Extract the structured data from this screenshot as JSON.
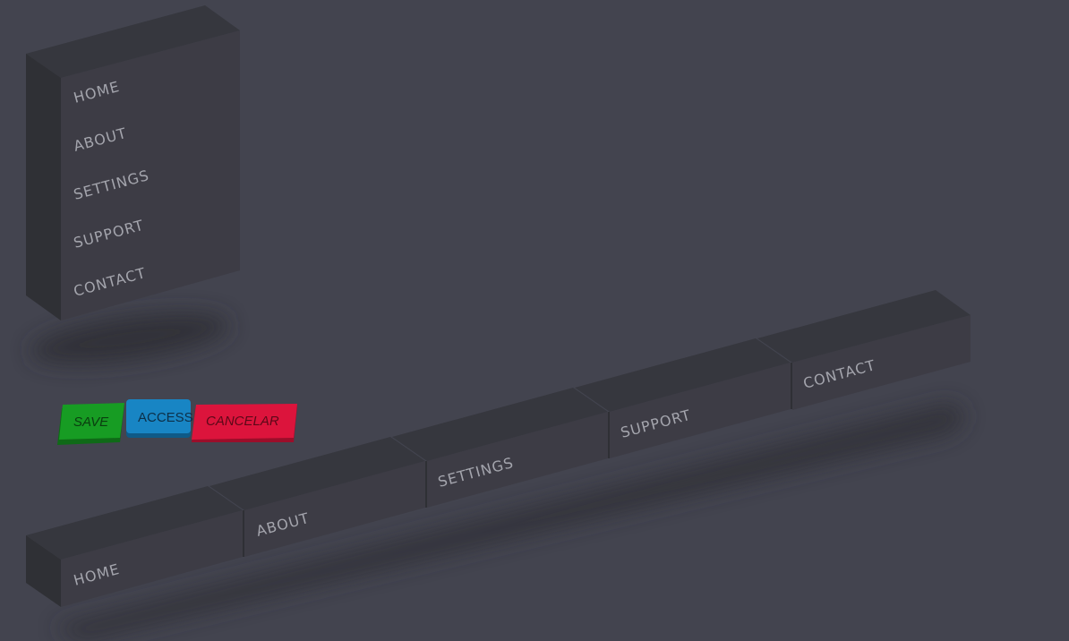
{
  "vertical_menu": {
    "items": [
      {
        "label": "HOME"
      },
      {
        "label": "ABOUT"
      },
      {
        "label": "SETTINGS"
      },
      {
        "label": "SUPPORT"
      },
      {
        "label": "CONTACT"
      }
    ]
  },
  "buttons": {
    "save": {
      "label": "SAVE",
      "color": "#179c23"
    },
    "access": {
      "label": "ACCESS",
      "color": "#1885c4"
    },
    "cancel": {
      "label": "CANCELAR",
      "color": "#dc143c"
    }
  },
  "horizontal_menu": {
    "items": [
      {
        "label": "HOME"
      },
      {
        "label": "ABOUT"
      },
      {
        "label": "SETTINGS"
      },
      {
        "label": "SUPPORT"
      },
      {
        "label": "CONTACT"
      }
    ]
  },
  "colors": {
    "background": "#43444f",
    "face": "#3d3c45",
    "top": "#36373e",
    "side": "#2f3035",
    "label": "#a4a5ad"
  }
}
